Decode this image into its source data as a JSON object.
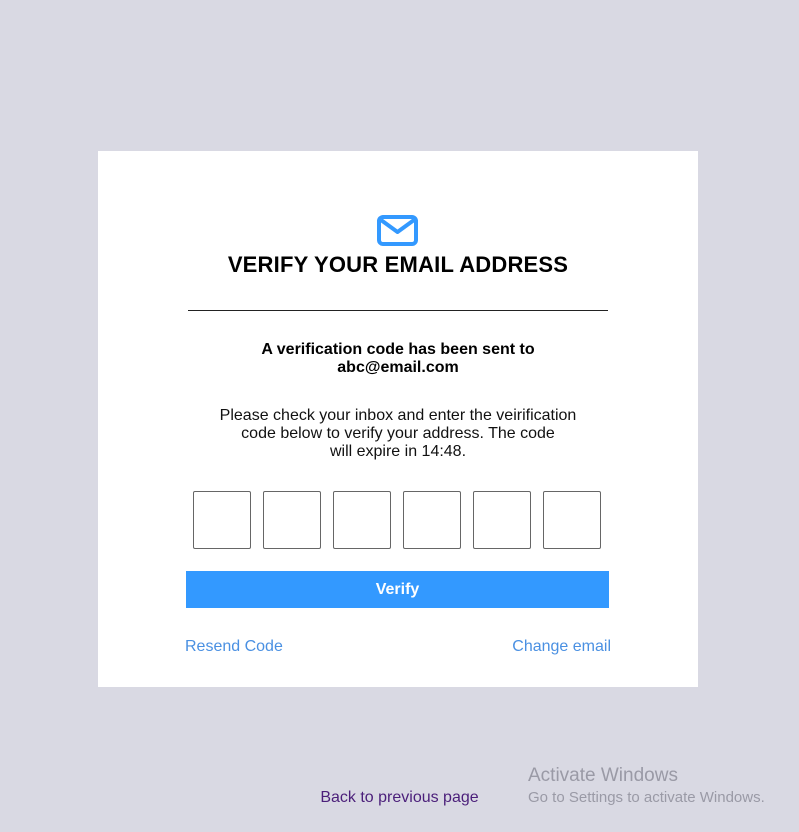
{
  "card": {
    "icon": "mail-icon",
    "title": "VERIFY YOUR EMAIL ADDRESS",
    "sent_line_1": "A verification code has been sent to",
    "sent_line_2": "abc@email.com",
    "instructions_line_1": "Please check your inbox and enter the veirification",
    "instructions_line_2": "code below to verify your address. The code",
    "instructions_line_3": "will expire in 14:48.",
    "code_boxes": [
      "",
      "",
      "",
      "",
      "",
      ""
    ],
    "verify_label": "Verify",
    "resend_label": "Resend Code",
    "change_email_label": "Change email"
  },
  "back_link_label": "Back to previous page",
  "watermark": {
    "title": "Activate Windows",
    "subtitle": "Go to Settings to activate Windows."
  },
  "colors": {
    "background": "#d9d9e3",
    "card": "#ffffff",
    "accent": "#3399ff",
    "link": "#4a90e2",
    "back_link": "#4b1f7a"
  }
}
